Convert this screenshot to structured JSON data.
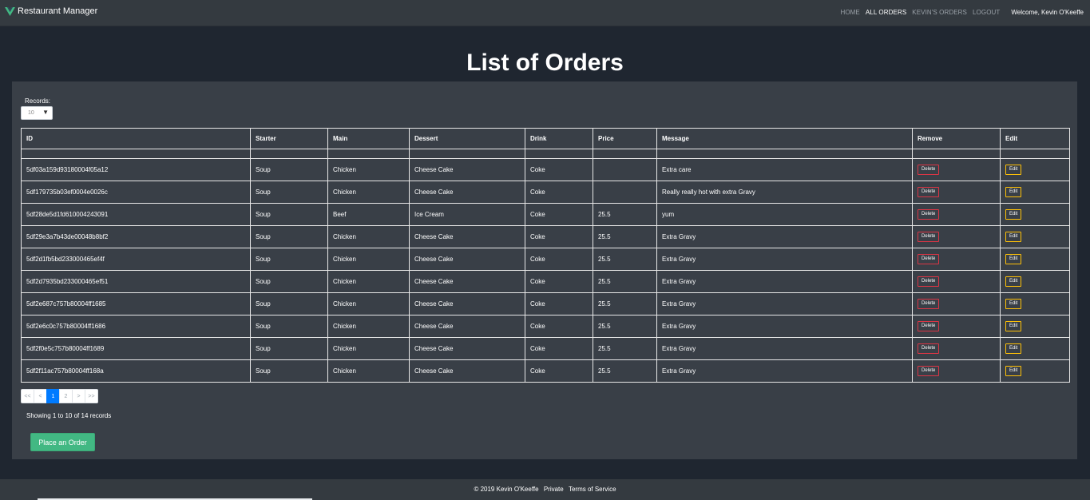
{
  "header": {
    "brand": "Restaurant Manager",
    "nav": [
      "HOME",
      "ALL ORDERS",
      "KEVIN'S ORDERS",
      "LOGOUT"
    ],
    "welcome": "Welcome, Kevin O'Keeffe"
  },
  "page_title": "List of Orders",
  "records": {
    "label": "Records:",
    "value": "10"
  },
  "table": {
    "columns": [
      "ID",
      "Starter",
      "Main",
      "Dessert",
      "Drink",
      "Price",
      "Message",
      "Remove",
      "Edit"
    ],
    "delete_label": "Delete",
    "edit_label": "Edit",
    "rows": [
      [
        "5df03a159d93180004f05a12",
        "Soup",
        "Chicken",
        "Cheese Cake",
        "Coke",
        "",
        "Extra care"
      ],
      [
        "5df179735b03ef0004e0026c",
        "Soup",
        "Chicken",
        "Cheese Cake",
        "Coke",
        "",
        "Really really hot with extra Gravy"
      ],
      [
        "5df28de5d1fd610004243091",
        "Soup",
        "Beef",
        "Ice Cream",
        "Coke",
        "25.5",
        "yum"
      ],
      [
        "5df29e3a7b43de00048b8bf2",
        "Soup",
        "Chicken",
        "Cheese Cake",
        "Coke",
        "25.5",
        "Extra Gravy"
      ],
      [
        "5df2d1fb5bd233000465ef4f",
        "Soup",
        "Chicken",
        "Cheese Cake",
        "Coke",
        "25.5",
        "Extra Gravy"
      ],
      [
        "5df2d7935bd233000465ef51",
        "Soup",
        "Chicken",
        "Cheese Cake",
        "Coke",
        "25.5",
        "Extra Gravy"
      ],
      [
        "5df2e687c757b80004ff1685",
        "Soup",
        "Chicken",
        "Cheese Cake",
        "Coke",
        "25.5",
        "Extra Gravy"
      ],
      [
        "5df2e6c0c757b80004ff1686",
        "Soup",
        "Chicken",
        "Cheese Cake",
        "Coke",
        "25.5",
        "Extra Gravy"
      ],
      [
        "5df2f0e5c757b80004ff1689",
        "Soup",
        "Chicken",
        "Cheese Cake",
        "Coke",
        "25.5",
        "Extra Gravy"
      ],
      [
        "5df2f11ac757b80004ff168a",
        "Soup",
        "Chicken",
        "Cheese Cake",
        "Coke",
        "25.5",
        "Extra Gravy"
      ]
    ]
  },
  "pagination": {
    "first": "<<",
    "prev": "<",
    "pages": [
      "1",
      "2"
    ],
    "current": "1",
    "next": ">",
    "last": ">>"
  },
  "showing": "Showing 1 to 10 of 14 records",
  "place_order_label": "Place an Order",
  "footer": {
    "copyright": "© 2019 Kevin O'Keeffe",
    "links": [
      "Private",
      "Terms of Service"
    ]
  },
  "colors": {
    "background": "#1f2630",
    "navbar": "#343a40",
    "panel": "#393f47",
    "brand_logo": "#42b883",
    "delete_border": "#dc3545",
    "edit_border": "#ffc107",
    "place_order": "#42b883",
    "pager_active": "#007bff"
  },
  "icons": {
    "brand": "vue-logo-icon",
    "records_dropdown": "dropdown-arrow-icon"
  }
}
